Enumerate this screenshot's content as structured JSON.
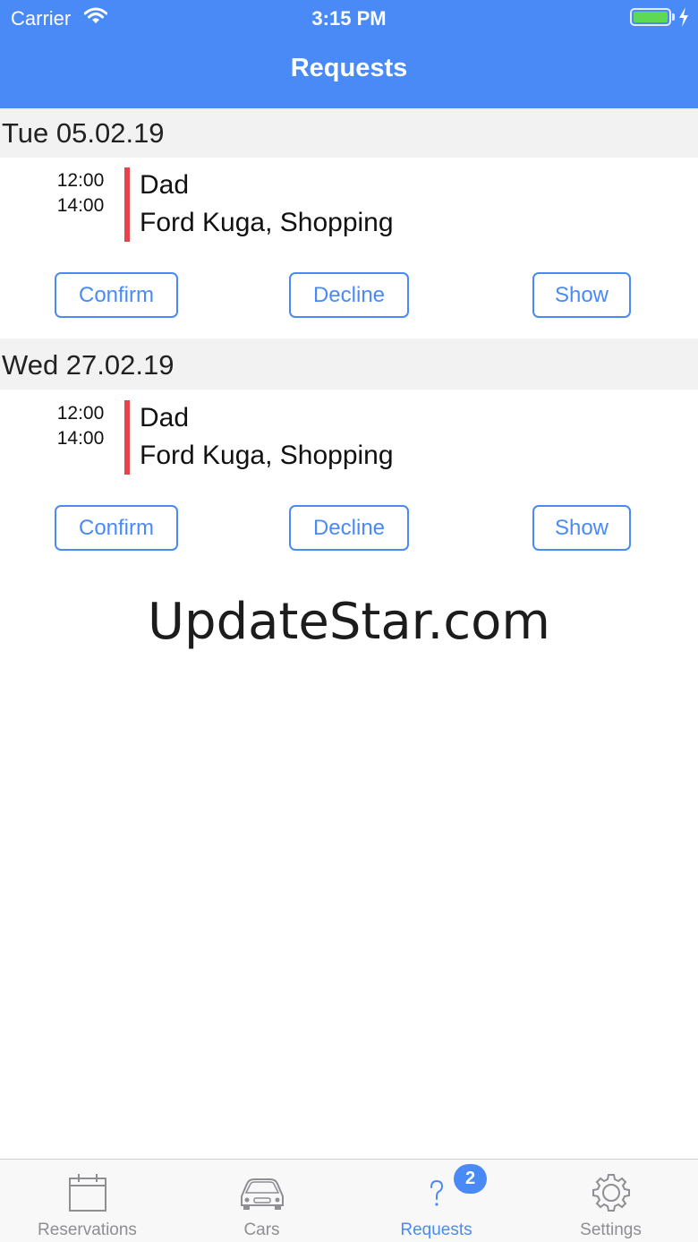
{
  "status_bar": {
    "carrier": "Carrier",
    "time": "3:15 PM"
  },
  "nav": {
    "title": "Requests"
  },
  "requests": [
    {
      "date": "Tue 05.02.19",
      "start": "12:00",
      "end": "14:00",
      "person": "Dad",
      "detail": "Ford Kuga, Shopping",
      "confirm_label": "Confirm",
      "decline_label": "Decline",
      "show_label": "Show"
    },
    {
      "date": "Wed 27.02.19",
      "start": "12:00",
      "end": "14:00",
      "person": "Dad",
      "detail": "Ford Kuga, Shopping",
      "confirm_label": "Confirm",
      "decline_label": "Decline",
      "show_label": "Show"
    }
  ],
  "watermark": "UpdateStar.com",
  "tabbar": {
    "tabs": [
      {
        "label": "Reservations",
        "icon": "calendar-icon"
      },
      {
        "label": "Cars",
        "icon": "car-icon"
      },
      {
        "label": "Requests",
        "icon": "question-icon",
        "badge": "2"
      },
      {
        "label": "Settings",
        "icon": "gear-icon"
      }
    ],
    "active_tab": "Requests"
  },
  "colors": {
    "accent": "#4a8af6",
    "event_bar": "#e8434a",
    "section_bg": "#f2f2f2",
    "battery": "#5fd855"
  }
}
